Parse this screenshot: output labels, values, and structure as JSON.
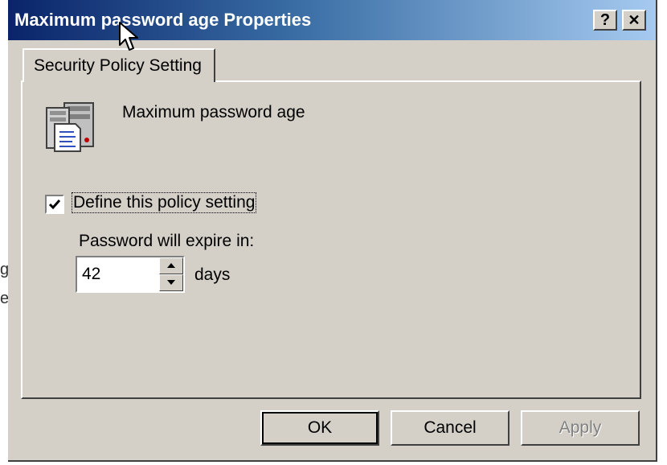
{
  "window": {
    "title": "Maximum password age Properties",
    "help_label": "?",
    "close_label": "✕"
  },
  "tabs": [
    {
      "label": "Security Policy Setting",
      "selected": true
    }
  ],
  "policy": {
    "name": "Maximum password age",
    "icon": "server-policy-icon"
  },
  "define_setting": {
    "label": "Define this policy setting",
    "checked": true
  },
  "expiry": {
    "label": "Password will expire in:",
    "value": "42",
    "unit": "days"
  },
  "buttons": {
    "ok": "OK",
    "cancel": "Cancel",
    "apply": "Apply"
  },
  "background_fragments": [
    "g",
    "e"
  ],
  "colors": {
    "title_start": "#0a246a",
    "title_end": "#a6caf0",
    "face": "#d4d0c8"
  }
}
